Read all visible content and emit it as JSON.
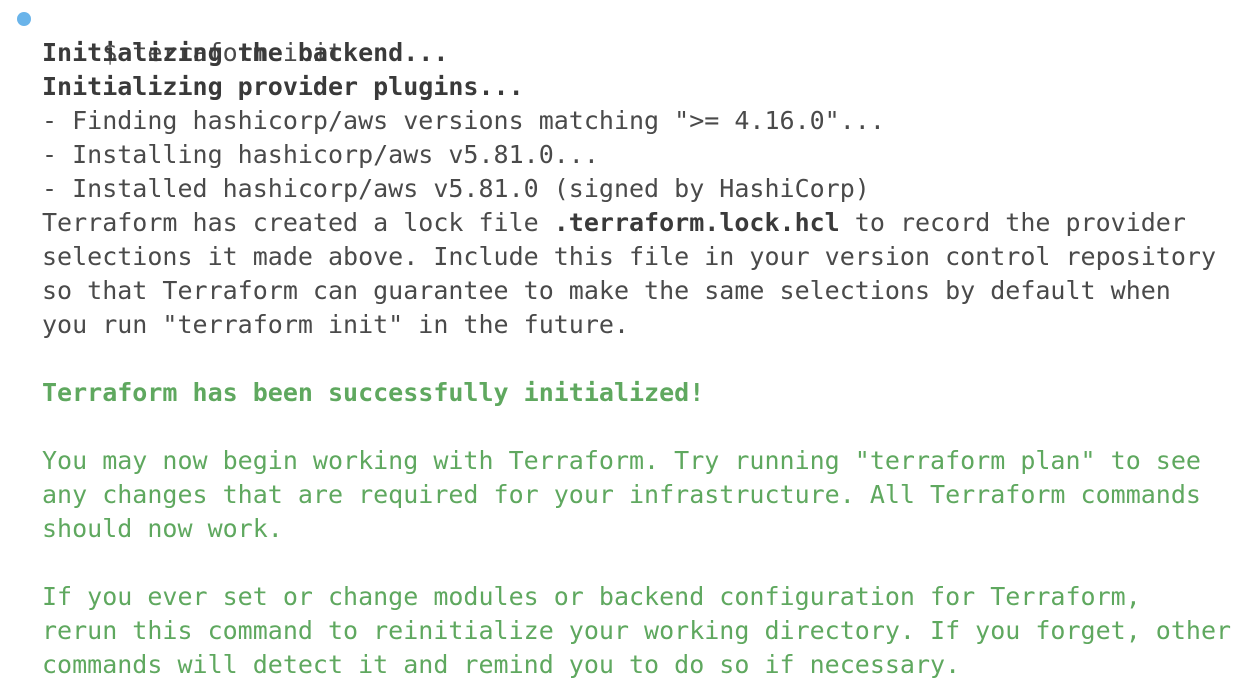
{
  "colors": {
    "prompt_dot": "#6ab4ea",
    "text": "#4a4a4a",
    "success": "#5fa85f"
  },
  "terminal": {
    "command": "$ terraform init",
    "backend": "Initializing the backend...",
    "provider": "Initializing provider plugins...",
    "finding": "- Finding hashicorp/aws versions matching \">= 4.16.0\"...",
    "installing": "- Installing hashicorp/aws v5.81.0...",
    "installed": "- Installed hashicorp/aws v5.81.0 (signed by HashiCorp)",
    "lock_pre": "Terraform has created a lock file ",
    "lock_file": ".terraform.lock.hcl",
    "lock_post": " to record the provider",
    "lock_2": "selections it made above. Include this file in your version control repository",
    "lock_3": "so that Terraform can guarantee to make the same selections by default when",
    "lock_4": "you run \"terraform init\" in the future.",
    "success": "Terraform has been successfully initialized!",
    "may_1": "You may now begin working with Terraform. Try running \"terraform plan\" to see",
    "may_2": "any changes that are required for your infrastructure. All Terraform commands",
    "may_3": "should now work.",
    "ever_1": "If you ever set or change modules or backend configuration for Terraform,",
    "ever_2": "rerun this command to reinitialize your working directory. If you forget, other",
    "ever_3": "commands will detect it and remind you to do so if necessary."
  }
}
